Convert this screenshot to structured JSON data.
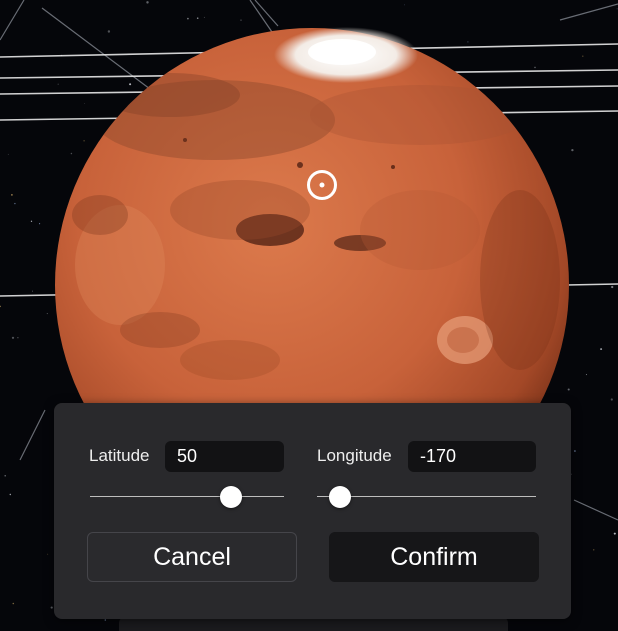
{
  "location": {
    "latitude": {
      "label": "Latitude",
      "value": "50",
      "min": -90,
      "max": 90
    },
    "longitude": {
      "label": "Longitude",
      "value": "-170",
      "min": -180,
      "max": 180
    }
  },
  "actions": {
    "cancel_label": "Cancel",
    "confirm_label": "Confirm"
  },
  "icons": {
    "location_marker": "target-marker-icon"
  },
  "colors": {
    "space": "#05060a",
    "planet": "#c8623a",
    "polar_cap": "#ffffff",
    "panel": "#29292c",
    "input": "#121214",
    "confirm_button": "#161618"
  }
}
